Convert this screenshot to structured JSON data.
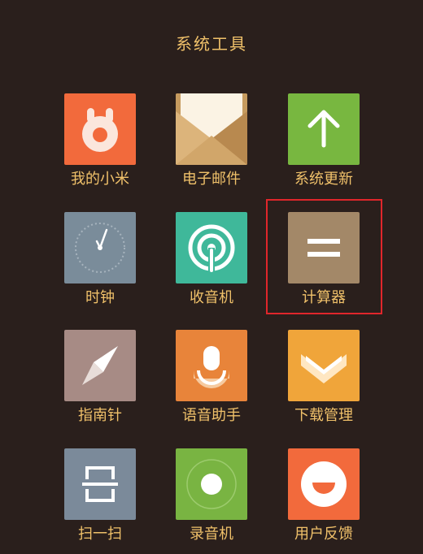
{
  "header": {
    "title": "系统工具"
  },
  "apps": [
    {
      "label": "我的小米",
      "icon": "mi-bunny-icon",
      "color": "#f26a3c"
    },
    {
      "label": "电子邮件",
      "icon": "envelope-icon",
      "color": "#c9a169"
    },
    {
      "label": "系统更新",
      "icon": "arrow-up-icon",
      "color": "#78b740"
    },
    {
      "label": "时钟",
      "icon": "clock-icon",
      "color": "#7a8c9a"
    },
    {
      "label": "收音机",
      "icon": "radio-signal-icon",
      "color": "#3fb89a"
    },
    {
      "label": "计算器",
      "icon": "equals-icon",
      "color": "#a38868"
    },
    {
      "label": "指南针",
      "icon": "compass-needle-icon",
      "color": "#a78b85"
    },
    {
      "label": "语音助手",
      "icon": "microphone-icon",
      "color": "#e8843a"
    },
    {
      "label": "下载管理",
      "icon": "download-chevron-icon",
      "color": "#f0a53a"
    },
    {
      "label": "扫一扫",
      "icon": "scan-frame-icon",
      "color": "#7b8a9a"
    },
    {
      "label": "录音机",
      "icon": "record-dot-icon",
      "color": "#79b442"
    },
    {
      "label": "用户反馈",
      "icon": "smile-face-icon",
      "color": "#f26a3c"
    }
  ],
  "selection": {
    "highlighted_app": "计算器",
    "highlight_color": "#e0262b"
  },
  "colors": {
    "background": "#2a1f1c",
    "label_text": "#f0c16a"
  }
}
